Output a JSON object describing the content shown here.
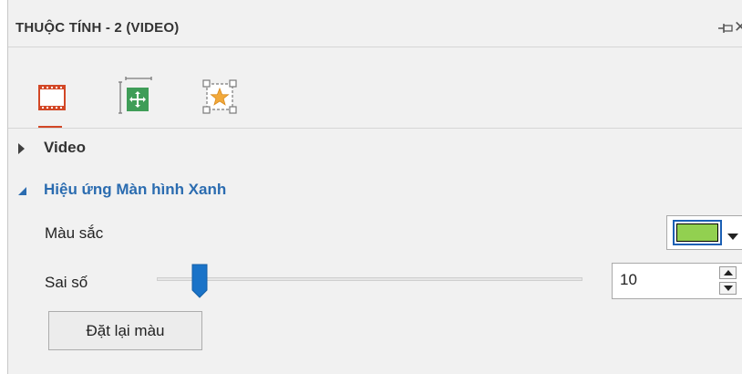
{
  "panel": {
    "title": "THUỘC TÍNH - 2 (VIDEO)",
    "tabs": [
      {
        "name": "video",
        "icon": "film-strip-icon",
        "active": true
      },
      {
        "name": "size",
        "icon": "move-resize-icon",
        "active": false
      },
      {
        "name": "effects",
        "icon": "star-frame-icon",
        "active": false
      }
    ]
  },
  "sections": {
    "video": {
      "label": "Video",
      "expanded": false
    },
    "green_screen": {
      "label": "Hiệu ứng Màn hình Xanh",
      "expanded": true
    }
  },
  "properties": {
    "color_label": "Màu sắc",
    "color_value": "#92d050",
    "tolerance_label": "Sai số",
    "tolerance_value": "10",
    "tolerance_fraction": 0.1,
    "reset_label": "Đặt lại màu"
  },
  "colors": {
    "panel_bg": "#f1f1f1",
    "accent": "#d24726",
    "section_blue": "#2b6cb0",
    "slider_thumb": "#1a73c8"
  }
}
